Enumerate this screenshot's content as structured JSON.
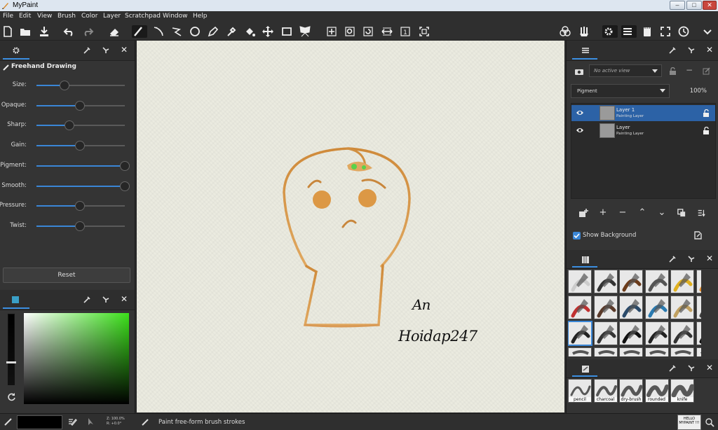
{
  "titlebar": {
    "title": "MyPaint",
    "minimize": "–",
    "maximize": "□",
    "close": "✕",
    "close_color": "#c9463d"
  },
  "menu": [
    "File",
    "Edit",
    "View",
    "Brush",
    "Color",
    "Layer",
    "Scratchpad",
    "Window",
    "Help"
  ],
  "toolbar": {
    "left_icons": [
      "new-document-icon",
      "open-document-icon",
      "save-icon",
      "undo-icon",
      "redo-icon",
      "eraser-icon"
    ],
    "tool_icons": [
      "freehand-brush-icon",
      "inking-icon",
      "lasso-icon",
      "ellipse-icon",
      "pen-icon",
      "color-picker-icon",
      "fill-icon",
      "move-icon",
      "frame-icon",
      "symmetry-icon"
    ],
    "view_icons": [
      "pan-icon",
      "zoom-icon",
      "rotate-icon",
      "mirror-icon",
      "reset-view-icon",
      "fit-view-icon"
    ],
    "right_icons": [
      "color-mixer-icon",
      "brush-settings-icon",
      "preferences-icon",
      "main-menu-icon",
      "scratchpad-icon",
      "fullscreen-icon",
      "history-icon"
    ]
  },
  "tool_options": {
    "brush_name": "Freehand Drawing",
    "sliders": [
      {
        "label": "Size:",
        "value": 0.32
      },
      {
        "label": "Opaque:",
        "value": 0.49
      },
      {
        "label": "Sharp:",
        "value": 0.37
      },
      {
        "label": "Gain:",
        "value": 0.49
      },
      {
        "label": "Pigment:",
        "value": 1.0
      },
      {
        "label": "Smooth:",
        "value": 1.0
      },
      {
        "label": "Pressure:",
        "value": 0.49
      },
      {
        "label": "Twist:",
        "value": 0.49
      }
    ],
    "reset_label": "Reset",
    "accent": "#3a86d6"
  },
  "color_panel": {
    "hue_color": "#3be01a"
  },
  "layers": {
    "view_placeholder": "No active view",
    "mode": "Pigment",
    "opacity": "100%",
    "items": [
      {
        "name": "Layer 1",
        "type": "Painting Layer",
        "selected": true
      },
      {
        "name": "Layer",
        "type": "Painting Layer",
        "selected": false
      }
    ],
    "show_background_label": "Show Background",
    "selected_color": "#2c62a6"
  },
  "brush_panel": {
    "brushes_top": [
      "pencil-light",
      "charcoal-squiggle",
      "ink-pen",
      "dry-squiggle",
      "yellow-stroke",
      "orange-smudge",
      "red-brush",
      "brown-brush",
      "water-drop",
      "blue-drop",
      "sponge",
      "spiral",
      "hello-mypaint",
      "marker",
      "pen-black",
      "brush-black",
      "blob",
      "blot-black"
    ],
    "labels": [
      "pencil",
      "charcoal",
      "dry-brush",
      "rounded",
      "knife"
    ]
  },
  "canvas_text": {
    "line1": "An",
    "line2": "Hoidap247"
  },
  "status": {
    "zoom_text": "Z: 100.0%",
    "rot_text": "R: +0.0°",
    "message": "Paint free-form brush strokes",
    "brush_preview": "HELLO MYPAINT !!!"
  }
}
